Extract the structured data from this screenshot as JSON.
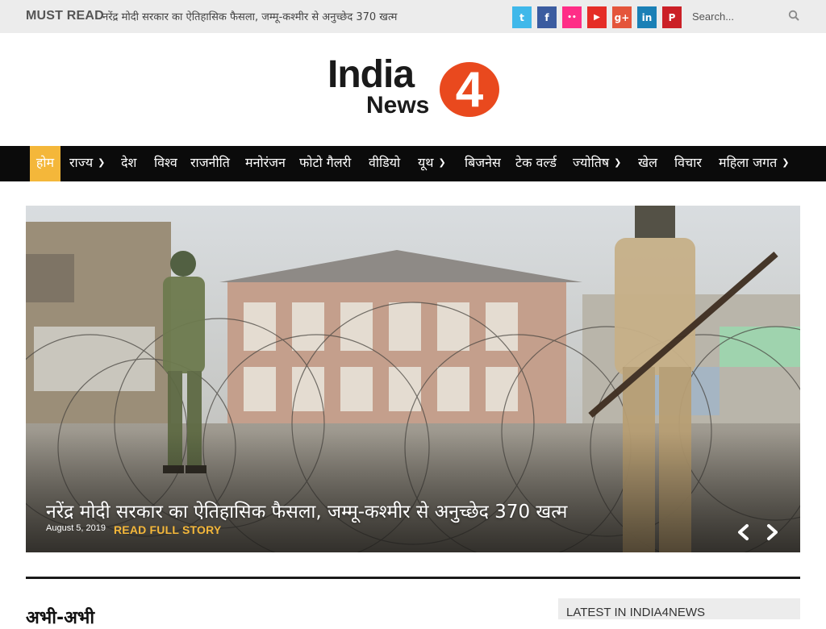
{
  "topbar": {
    "must_read_label": "MUST READ",
    "ticker_text": "नरेंद्र मोदी सरकार का ऐतिहासिक फैसला, जम्मू-कश्मीर से अनुच्छेद 370 खत्म",
    "social": [
      {
        "name": "twitter",
        "glyph": "t",
        "color": "#3fb8ea"
      },
      {
        "name": "facebook",
        "glyph": "f",
        "color": "#3b5ca0"
      },
      {
        "name": "flickr",
        "glyph": "••",
        "color": "#ff2d87"
      },
      {
        "name": "youtube",
        "glyph": "▶",
        "color": "#e52d27"
      },
      {
        "name": "google-plus",
        "glyph": "g+",
        "color": "#e4553b"
      },
      {
        "name": "linkedin",
        "glyph": "in",
        "color": "#1a80b6"
      },
      {
        "name": "pinterest",
        "glyph": "P",
        "color": "#cb2027"
      }
    ],
    "search_placeholder": "Search..."
  },
  "logo": {
    "word1": "India",
    "word2": "News",
    "number": "4",
    "colors": {
      "circle": "#e9491e",
      "text": "#1a1a1a"
    }
  },
  "nav": {
    "items": [
      {
        "label": "होम",
        "active": true,
        "dropdown": false
      },
      {
        "label": "राज्य",
        "active": false,
        "dropdown": true
      },
      {
        "label": "देश",
        "active": false,
        "dropdown": false
      },
      {
        "label": "विश्व",
        "active": false,
        "dropdown": false
      },
      {
        "label": "राजनीति",
        "active": false,
        "dropdown": false
      },
      {
        "label": "मनोरंजन",
        "active": false,
        "dropdown": false
      },
      {
        "label": "फोटो गैलरी",
        "active": false,
        "dropdown": false
      },
      {
        "label": "वीडियो",
        "active": false,
        "dropdown": false
      },
      {
        "label": "यूथ",
        "active": false,
        "dropdown": true
      },
      {
        "label": "बिजनेस",
        "active": false,
        "dropdown": false
      },
      {
        "label": "टेक वर्ल्ड",
        "active": false,
        "dropdown": false
      },
      {
        "label": "ज्योतिष",
        "active": false,
        "dropdown": true
      },
      {
        "label": "खेल",
        "active": false,
        "dropdown": false
      },
      {
        "label": "विचार",
        "active": false,
        "dropdown": false
      },
      {
        "label": "महिला जगत",
        "active": false,
        "dropdown": true
      }
    ],
    "colors": {
      "background": "#0b0b0b",
      "active": "#f4b73a"
    }
  },
  "slider": {
    "title": "नरेंद्र मोदी सरकार का ऐतिहासिक फैसला, जम्मू-कश्मीर से अनुच्छेद 370 खत्म",
    "date": "August 5, 2019",
    "read_more": "READ FULL STORY",
    "image_description": "soldiers-behind-barbed-wire"
  },
  "sections": {
    "left_title": "अभी-अभी",
    "latest_title": "LATEST IN INDIA4NEWS"
  }
}
